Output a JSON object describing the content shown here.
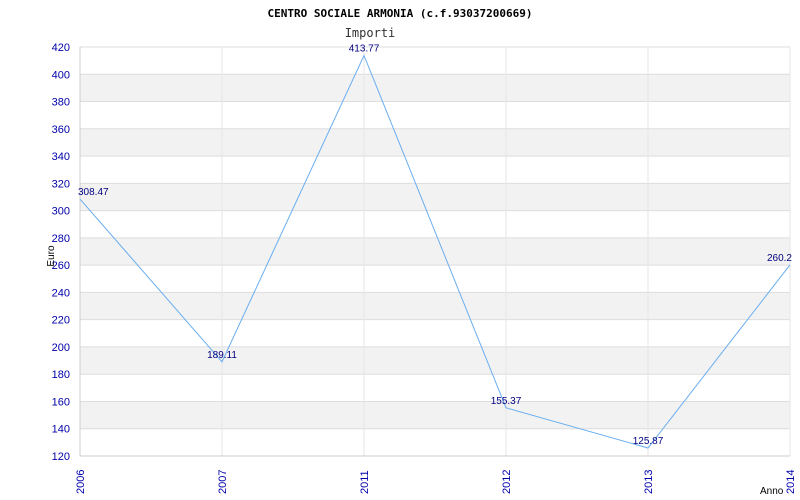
{
  "chart_data": {
    "type": "line",
    "title": "CENTRO SOCIALE ARMONIA (c.f.93037200669)",
    "subtitle": "Importi",
    "xlabel": "Anno",
    "ylabel": "Euro",
    "categories": [
      "2006",
      "2007",
      "2011",
      "2012",
      "2013",
      "2014"
    ],
    "values": [
      308.47,
      189.11,
      413.77,
      155.37,
      125.87,
      260.2
    ],
    "value_labels": [
      "308.47",
      "189.11",
      "413.77",
      "155.37",
      "125.87",
      "260.2"
    ],
    "ylim": [
      120,
      420
    ],
    "yticks": [
      120,
      140,
      160,
      180,
      200,
      220,
      240,
      260,
      280,
      300,
      320,
      340,
      360,
      380,
      400,
      420
    ],
    "grid": true,
    "colors": {
      "line": "#6aaef0",
      "band_alt": "#f2f2f2",
      "band": "#ffffff",
      "gridline": "#dddddd",
      "tick_text": "#0000aa",
      "data_label": "#000080"
    }
  }
}
